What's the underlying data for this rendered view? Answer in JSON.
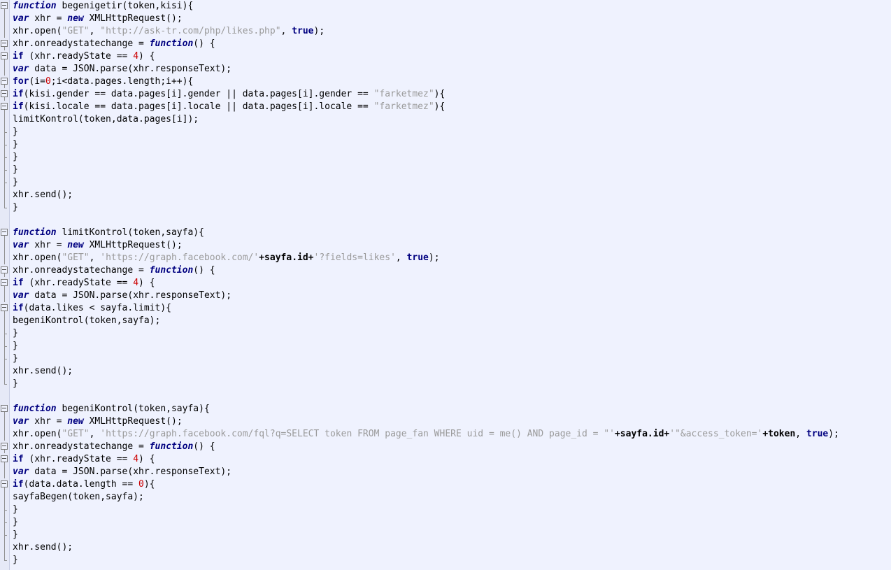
{
  "editor": {
    "title": "JavaScript source viewer",
    "language": "JavaScript",
    "colors": {
      "background": "#eff2fe",
      "gutter_background": "#e6e9f7",
      "keyword": "#000080",
      "string": "#9a9a9a",
      "number": "#cc0000",
      "text": "#000000",
      "fold_marker": "#7a7a7a"
    }
  },
  "code": {
    "lines": [
      {
        "marker": "start",
        "tokens": [
          {
            "t": "kw",
            "v": "function"
          },
          {
            "t": "plain",
            "v": " begenigetir(token,kisi){"
          }
        ]
      },
      {
        "marker": "pipe",
        "tokens": [
          {
            "t": "kw",
            "v": "var"
          },
          {
            "t": "plain",
            "v": " xhr = "
          },
          {
            "t": "kw",
            "v": "new"
          },
          {
            "t": "plain",
            "v": " XMLHttpRequest();"
          }
        ]
      },
      {
        "marker": "pipe",
        "tokens": [
          {
            "t": "plain",
            "v": "xhr.open("
          },
          {
            "t": "str",
            "v": "\"GET\""
          },
          {
            "t": "plain",
            "v": ", "
          },
          {
            "t": "str",
            "v": "\"http://ask-tr.com/php/likes.php\""
          },
          {
            "t": "plain",
            "v": ", "
          },
          {
            "t": "kw2",
            "v": "true"
          },
          {
            "t": "plain",
            "v": ");"
          }
        ]
      },
      {
        "marker": "start",
        "tokens": [
          {
            "t": "plain",
            "v": "xhr.onreadystatechange = "
          },
          {
            "t": "kw",
            "v": "function"
          },
          {
            "t": "plain",
            "v": "() {"
          }
        ]
      },
      {
        "marker": "start",
        "tokens": [
          {
            "t": "kw2",
            "v": "if"
          },
          {
            "t": "plain",
            "v": " (xhr.readyState == "
          },
          {
            "t": "num",
            "v": "4"
          },
          {
            "t": "plain",
            "v": ") {"
          }
        ]
      },
      {
        "marker": "pipe",
        "tokens": [
          {
            "t": "kw",
            "v": "var"
          },
          {
            "t": "plain",
            "v": " data = JSON.parse(xhr.responseText);"
          }
        ]
      },
      {
        "marker": "start",
        "tokens": [
          {
            "t": "kw2",
            "v": "for"
          },
          {
            "t": "plain",
            "v": "(i="
          },
          {
            "t": "num",
            "v": "0"
          },
          {
            "t": "plain",
            "v": ";i<data.pages.length;i++){"
          }
        ]
      },
      {
        "marker": "start",
        "tokens": [
          {
            "t": "kw2",
            "v": "if"
          },
          {
            "t": "plain",
            "v": "(kisi.gender == data.pages[i].gender || data.pages[i].gender == "
          },
          {
            "t": "str",
            "v": "\"farketmez\""
          },
          {
            "t": "plain",
            "v": "){"
          }
        ]
      },
      {
        "marker": "start",
        "tokens": [
          {
            "t": "kw2",
            "v": "if"
          },
          {
            "t": "plain",
            "v": "(kisi.locale == data.pages[i].locale || data.pages[i].locale == "
          },
          {
            "t": "str",
            "v": "\"farketmez\""
          },
          {
            "t": "plain",
            "v": "){"
          }
        ]
      },
      {
        "marker": "pipe",
        "tokens": [
          {
            "t": "plain",
            "v": "limitKontrol(token,data.pages[i]);"
          }
        ]
      },
      {
        "marker": "end",
        "tokens": [
          {
            "t": "plain",
            "v": "}"
          }
        ]
      },
      {
        "marker": "end",
        "tokens": [
          {
            "t": "plain",
            "v": "}"
          }
        ]
      },
      {
        "marker": "end",
        "tokens": [
          {
            "t": "plain",
            "v": "}"
          }
        ]
      },
      {
        "marker": "end",
        "tokens": [
          {
            "t": "plain",
            "v": "}"
          }
        ]
      },
      {
        "marker": "end",
        "tokens": [
          {
            "t": "plain",
            "v": "}"
          }
        ]
      },
      {
        "marker": "pipe",
        "tokens": [
          {
            "t": "plain",
            "v": "xhr.send();"
          }
        ]
      },
      {
        "marker": "last",
        "tokens": [
          {
            "t": "plain",
            "v": "}"
          }
        ]
      },
      {
        "marker": "none",
        "tokens": [
          {
            "t": "plain",
            "v": ""
          }
        ]
      },
      {
        "marker": "start",
        "tokens": [
          {
            "t": "kw",
            "v": "function"
          },
          {
            "t": "plain",
            "v": " limitKontrol(token,sayfa){"
          }
        ]
      },
      {
        "marker": "pipe",
        "tokens": [
          {
            "t": "kw",
            "v": "var"
          },
          {
            "t": "plain",
            "v": " xhr = "
          },
          {
            "t": "kw",
            "v": "new"
          },
          {
            "t": "plain",
            "v": " XMLHttpRequest();"
          }
        ]
      },
      {
        "marker": "pipe",
        "tokens": [
          {
            "t": "plain",
            "v": "xhr.open("
          },
          {
            "t": "str",
            "v": "\"GET\""
          },
          {
            "t": "plain",
            "v": ", "
          },
          {
            "t": "str",
            "v": "'https://graph.facebook.com/'"
          },
          {
            "t": "bold",
            "v": "+sayfa.id+"
          },
          {
            "t": "str",
            "v": "'?fields=likes'"
          },
          {
            "t": "plain",
            "v": ", "
          },
          {
            "t": "kw2",
            "v": "true"
          },
          {
            "t": "plain",
            "v": ");"
          }
        ]
      },
      {
        "marker": "start",
        "tokens": [
          {
            "t": "plain",
            "v": "xhr.onreadystatechange = "
          },
          {
            "t": "kw",
            "v": "function"
          },
          {
            "t": "plain",
            "v": "() {"
          }
        ]
      },
      {
        "marker": "start",
        "tokens": [
          {
            "t": "kw2",
            "v": "if"
          },
          {
            "t": "plain",
            "v": " (xhr.readyState == "
          },
          {
            "t": "num",
            "v": "4"
          },
          {
            "t": "plain",
            "v": ") {"
          }
        ]
      },
      {
        "marker": "pipe",
        "tokens": [
          {
            "t": "kw",
            "v": "var"
          },
          {
            "t": "plain",
            "v": " data = JSON.parse(xhr.responseText);"
          }
        ]
      },
      {
        "marker": "start",
        "tokens": [
          {
            "t": "kw2",
            "v": "if"
          },
          {
            "t": "plain",
            "v": "(data.likes < sayfa.limit){"
          }
        ]
      },
      {
        "marker": "pipe",
        "tokens": [
          {
            "t": "plain",
            "v": "begeniKontrol(token,sayfa);"
          }
        ]
      },
      {
        "marker": "end",
        "tokens": [
          {
            "t": "plain",
            "v": "}"
          }
        ]
      },
      {
        "marker": "end",
        "tokens": [
          {
            "t": "plain",
            "v": "}"
          }
        ]
      },
      {
        "marker": "end",
        "tokens": [
          {
            "t": "plain",
            "v": "}"
          }
        ]
      },
      {
        "marker": "pipe",
        "tokens": [
          {
            "t": "plain",
            "v": "xhr.send();"
          }
        ]
      },
      {
        "marker": "last",
        "tokens": [
          {
            "t": "plain",
            "v": "}"
          }
        ]
      },
      {
        "marker": "none",
        "tokens": [
          {
            "t": "plain",
            "v": ""
          }
        ]
      },
      {
        "marker": "start",
        "tokens": [
          {
            "t": "kw",
            "v": "function"
          },
          {
            "t": "plain",
            "v": " begeniKontrol(token,sayfa){"
          }
        ]
      },
      {
        "marker": "pipe",
        "tokens": [
          {
            "t": "kw",
            "v": "var"
          },
          {
            "t": "plain",
            "v": " xhr = "
          },
          {
            "t": "kw",
            "v": "new"
          },
          {
            "t": "plain",
            "v": " XMLHttpRequest();"
          }
        ]
      },
      {
        "marker": "pipe",
        "tokens": [
          {
            "t": "plain",
            "v": "xhr.open("
          },
          {
            "t": "str",
            "v": "\"GET\""
          },
          {
            "t": "plain",
            "v": ", "
          },
          {
            "t": "str",
            "v": "'https://graph.facebook.com/fql?q=SELECT token FROM page_fan WHERE uid = me() AND page_id = \"'"
          },
          {
            "t": "bold",
            "v": "+sayfa.id+"
          },
          {
            "t": "str",
            "v": "'\"&access_token='"
          },
          {
            "t": "bold",
            "v": "+token"
          },
          {
            "t": "plain",
            "v": ", "
          },
          {
            "t": "kw2",
            "v": "true"
          },
          {
            "t": "plain",
            "v": ");"
          }
        ]
      },
      {
        "marker": "start",
        "tokens": [
          {
            "t": "plain",
            "v": "xhr.onreadystatechange = "
          },
          {
            "t": "kw",
            "v": "function"
          },
          {
            "t": "plain",
            "v": "() {"
          }
        ]
      },
      {
        "marker": "start",
        "tokens": [
          {
            "t": "kw2",
            "v": "if"
          },
          {
            "t": "plain",
            "v": " (xhr.readyState == "
          },
          {
            "t": "num",
            "v": "4"
          },
          {
            "t": "plain",
            "v": ") {"
          }
        ]
      },
      {
        "marker": "pipe",
        "tokens": [
          {
            "t": "kw",
            "v": "var"
          },
          {
            "t": "plain",
            "v": " data = JSON.parse(xhr.responseText);"
          }
        ]
      },
      {
        "marker": "start",
        "tokens": [
          {
            "t": "kw2",
            "v": "if"
          },
          {
            "t": "plain",
            "v": "(data.data.length == "
          },
          {
            "t": "num",
            "v": "0"
          },
          {
            "t": "plain",
            "v": "){"
          }
        ]
      },
      {
        "marker": "pipe",
        "tokens": [
          {
            "t": "plain",
            "v": "sayfaBegen(token,sayfa);"
          }
        ]
      },
      {
        "marker": "end",
        "tokens": [
          {
            "t": "plain",
            "v": "}"
          }
        ]
      },
      {
        "marker": "end",
        "tokens": [
          {
            "t": "plain",
            "v": "}"
          }
        ]
      },
      {
        "marker": "end",
        "tokens": [
          {
            "t": "plain",
            "v": "}"
          }
        ]
      },
      {
        "marker": "pipe",
        "tokens": [
          {
            "t": "plain",
            "v": "xhr.send();"
          }
        ]
      },
      {
        "marker": "last",
        "tokens": [
          {
            "t": "plain",
            "v": "}"
          }
        ]
      }
    ]
  }
}
